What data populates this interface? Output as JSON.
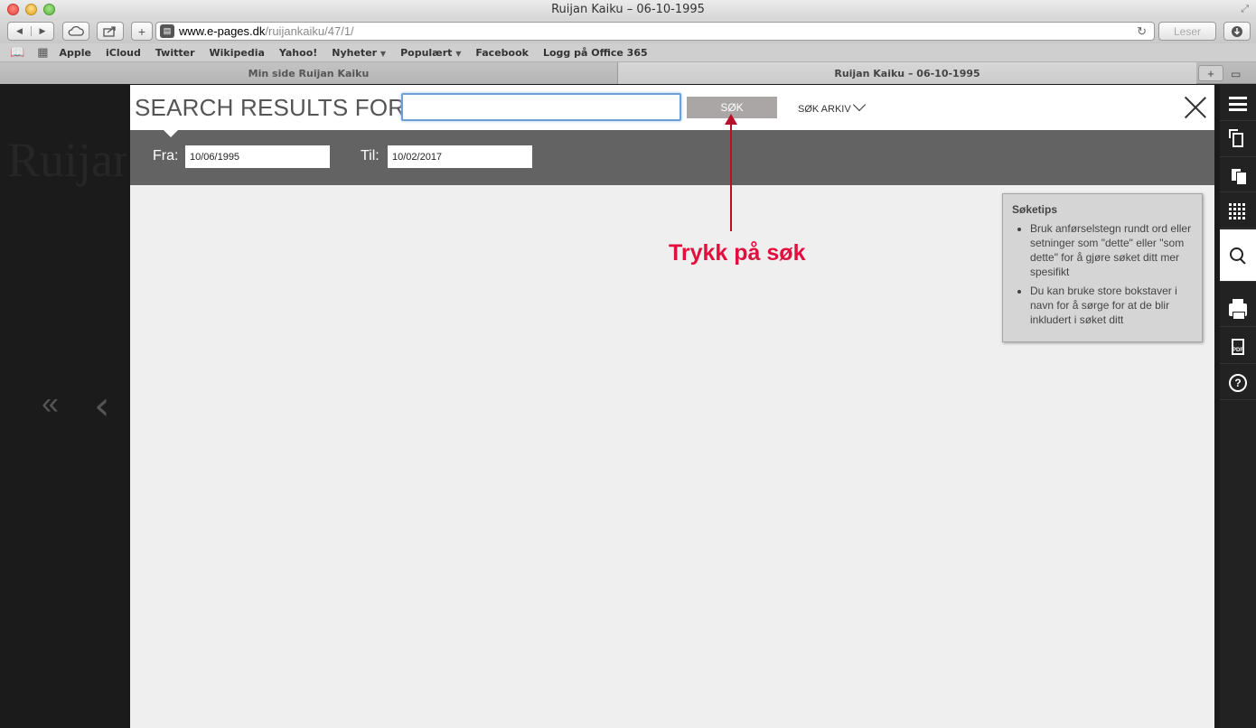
{
  "window": {
    "title": "Ruijan Kaiku – 06-10-1995"
  },
  "toolbar": {
    "back_icon": "◀",
    "forward_icon": "▶",
    "url_domain": "www.e-pages.dk",
    "url_path": "/ruijankaiku/47/1/",
    "reader_label": "Leser"
  },
  "bookmarks": [
    {
      "label": "Apple"
    },
    {
      "label": "iCloud"
    },
    {
      "label": "Twitter"
    },
    {
      "label": "Wikipedia"
    },
    {
      "label": "Yahoo!"
    },
    {
      "label": "Nyheter"
    },
    {
      "label": "Populært"
    },
    {
      "label": "Facebook"
    },
    {
      "label": "Logg på Office 365"
    }
  ],
  "tabs": [
    {
      "label": "Min side Ruijan Kaiku"
    },
    {
      "label": "Ruijan Kaiku – 06-10-1995"
    }
  ],
  "left_panel": {
    "logo_text": "Ruijan",
    "first_page_icon": "«",
    "prev_page_icon": "‹"
  },
  "search": {
    "title": "SEARCH RESULTS FOR:",
    "input_value": "",
    "button_label": "SØK",
    "archive_label": "SØK ARKIV",
    "from_label": "Fra:",
    "from_value": "10/06/1995",
    "to_label": "Til:",
    "to_value": "10/02/2017"
  },
  "tips": {
    "title": "Søketips",
    "items": [
      "Bruk anførselstegn rundt ord eller setninger som \"dette\" eller \"som dette\" for å gjøre søket ditt mer spesifikt",
      "Du kan bruke store bokstaver i navn for å sørge for at de blir inkludert i søket ditt"
    ]
  },
  "annotation": {
    "text": "Trykk på søk",
    "color": "#e0103e"
  },
  "colors": {
    "accent_input_border": "#6e9fd6",
    "search_button_bg": "#aaa6a6",
    "date_bar_bg": "#636363",
    "arrow_color": "#b8102a"
  }
}
